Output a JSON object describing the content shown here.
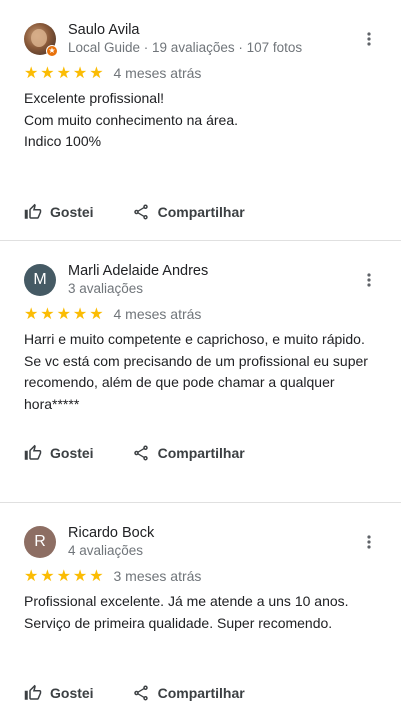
{
  "reviews": [
    {
      "author": "Saulo Avila",
      "meta": "Local Guide · 19 avaliações · 107 fotos",
      "avatar_initial": "",
      "avatar_color": "#8a5a3a",
      "local_guide_badge": true,
      "stars": 5,
      "time": "4 meses atrás",
      "text": "Excelente profissional!\nCom muito conhecimento na área.\nIndico 100%"
    },
    {
      "author": "Marli Adelaide Andres",
      "meta": "3 avaliações",
      "avatar_initial": "M",
      "avatar_color": "#455a64",
      "local_guide_badge": false,
      "stars": 5,
      "time": "4 meses atrás",
      "text": "Harri e muito competente e caprichoso, e muito rápido. Se vc está com precisando de um profissional  eu super recomendo,  além de que pode chamar a qualquer hora*****"
    },
    {
      "author": "Ricardo Bock",
      "meta": "4 avaliações",
      "avatar_initial": "R",
      "avatar_color": "#8d6e63",
      "local_guide_badge": false,
      "stars": 5,
      "time": "3 meses atrás",
      "text": "Profissional excelente. Já me atende a uns 10 anos. Serviço de primeira qualidade. Super recomendo."
    }
  ],
  "actions": {
    "like_label": "Gostei",
    "share_label": "Compartilhar"
  },
  "colors": {
    "star": "#fbbc04",
    "meta_text": "#70757a",
    "divider": "#e0e0e0"
  },
  "icons": {
    "more": "more-vert-icon",
    "like": "thumb-up-icon",
    "share": "share-icon",
    "star": "star-icon",
    "badge": "local-guide-badge-icon"
  }
}
